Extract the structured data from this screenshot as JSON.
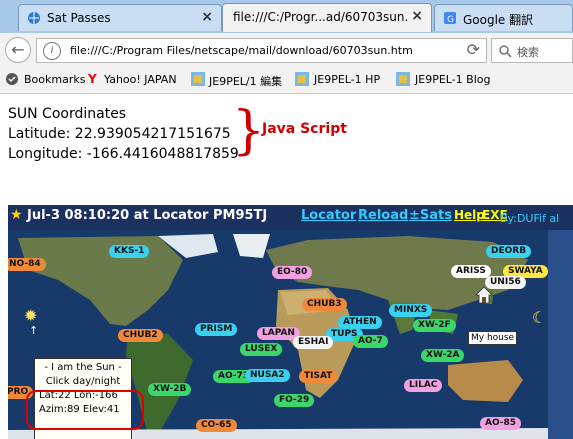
{
  "tabs": [
    {
      "label": "Sat Passes",
      "close": "×"
    },
    {
      "label": "file:///C:/Progr...ad/60703sun.htm",
      "close": "×"
    },
    {
      "label": "Google 翻訳",
      "close": "×"
    }
  ],
  "nav": {
    "back": "←",
    "info": "i",
    "url": "file:///C:/Program Files/netscape/mail/download/60703sun.htm",
    "reload": "⟳",
    "search_placeholder": "検索"
  },
  "bookmarks": [
    {
      "label": "Bookmarks",
      "icon": "bookmarks-icon"
    },
    {
      "label": "Yahoo! JAPAN",
      "icon": "yahoo-icon"
    },
    {
      "label": "JE9PEL/1 編集",
      "icon": "site-icon"
    },
    {
      "label": "JE9PEL-1 HP",
      "icon": "site-icon"
    },
    {
      "label": "JE9PEL-1 Blog",
      "icon": "site-icon"
    }
  ],
  "page": {
    "heading": "SUN Coordinates",
    "latitude": "Latitude: 22.939054217151675",
    "longitude": "Longitude: -166.4416048817859",
    "annotation": "Java Script",
    "brace": "}"
  },
  "map": {
    "title": "Jul-3 08:10:20 at Locator PM95TJ",
    "links": [
      "Locator",
      "Reload",
      "±Sats",
      "Help",
      "EXE"
    ],
    "credit": "By:DUFif al",
    "popup": [
      "- I am the Sun -",
      "Click day/night",
      "Lat:22 Lon:-166",
      "Azim:89 Elev:41"
    ],
    "house_label": "My house",
    "satellites": [
      {
        "label": "KKS-1",
        "color": "#3ad0f0"
      },
      {
        "label": "NO-84",
        "color": "#f08a3a"
      },
      {
        "label": "EO-80",
        "color": "#f2a0e0"
      },
      {
        "label": "DEORB",
        "color": "#3ad0f0"
      },
      {
        "label": "ARISS",
        "color": "#ffffff"
      },
      {
        "label": "SWAYA",
        "color": "#ffe640"
      },
      {
        "label": "UNI56",
        "color": "#f4f4f4"
      },
      {
        "label": "CHUB3",
        "color": "#f08a3a"
      },
      {
        "label": "MINXS",
        "color": "#3ad0f0"
      },
      {
        "label": "ATHEN",
        "color": "#3ad0f0"
      },
      {
        "label": "XW-2F",
        "color": "#3ad86a"
      },
      {
        "label": "PRISM",
        "color": "#3ad0f0"
      },
      {
        "label": "LAPAN",
        "color": "#f2a0e0"
      },
      {
        "label": "TUPS",
        "color": "#3ad0f0"
      },
      {
        "label": "ESHAI",
        "color": "#f4f4f4"
      },
      {
        "label": "AO-7",
        "color": "#3ad86a"
      },
      {
        "label": "CHUB2",
        "color": "#f08a3a"
      },
      {
        "label": "LUSEX",
        "color": "#3ad86a"
      },
      {
        "label": "XW-2A",
        "color": "#3ad86a"
      },
      {
        "label": "AO-73",
        "color": "#3ad86a"
      },
      {
        "label": "NUSA2",
        "color": "#3ad0f0"
      },
      {
        "label": "TISAT",
        "color": "#f08a3a"
      },
      {
        "label": "LILAC",
        "color": "#f2a0e0"
      },
      {
        "label": "XW-2B",
        "color": "#3ad86a"
      },
      {
        "label": "PRO",
        "color": "#f08a3a"
      },
      {
        "label": "FO-29",
        "color": "#3ad86a"
      },
      {
        "label": "CO-65",
        "color": "#f08a3a"
      },
      {
        "label": "AO-85",
        "color": "#f2a0e0"
      }
    ]
  }
}
